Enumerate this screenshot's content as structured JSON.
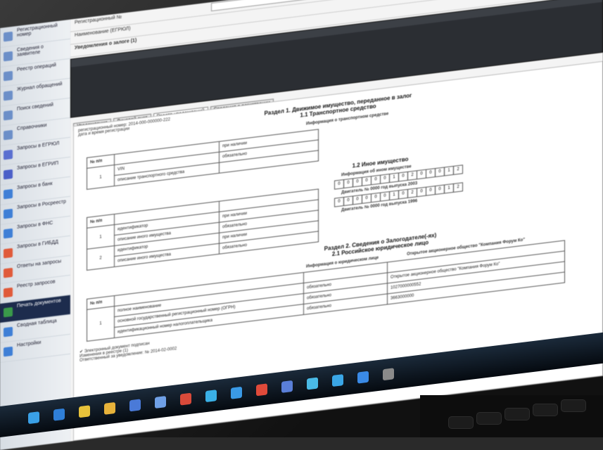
{
  "sidebar": {
    "items": [
      {
        "label": "Регистрационный номер",
        "icon": "document-icon",
        "color": "#6c8fc8"
      },
      {
        "label": "Сведения о заявителе",
        "icon": "document-icon",
        "color": "#6c8fc8"
      },
      {
        "label": "Реестр операций",
        "icon": "document-icon",
        "color": "#6c8fc8"
      },
      {
        "label": "Журнал обращений",
        "icon": "document-icon",
        "color": "#6c8fc8"
      },
      {
        "label": "Поиск сведений",
        "icon": "document-icon",
        "color": "#6c8fc8"
      },
      {
        "label": "Справочники",
        "icon": "document-icon",
        "color": "#6c8fc8"
      },
      {
        "label": "Запросы в ЕГРЮЛ",
        "icon": "folder-icon",
        "color": "#5a6fd0"
      },
      {
        "label": "Запросы в ЕГРИП",
        "icon": "folder-icon",
        "color": "#4b5fc8"
      },
      {
        "label": "Запросы в банк",
        "icon": "folder-icon",
        "color": "#3f7fd6"
      },
      {
        "label": "Запросы в Росреестр",
        "icon": "folder-icon",
        "color": "#3f7fd6"
      },
      {
        "label": "Запросы в ФНС",
        "icon": "folder-icon",
        "color": "#3f7fd6"
      },
      {
        "label": "Запросы в ГИБДД",
        "icon": "folder-icon",
        "color": "#e05a3a"
      },
      {
        "label": "Ответы на запросы",
        "icon": "folder-icon",
        "color": "#e05a3a"
      },
      {
        "label": "Реестр запросов",
        "icon": "folder-icon",
        "color": "#e05a3a"
      },
      {
        "label": "Печать документов",
        "icon": "printer-icon",
        "color": "#3a9a4a"
      },
      {
        "label": "Сводная таблица",
        "icon": "table-icon",
        "color": "#3f7fd6"
      },
      {
        "label": "Настройки",
        "icon": "gear-icon",
        "color": "#3f7fd6"
      }
    ]
  },
  "top": {
    "field1": "Регистрационный №",
    "field2": "Наименование (ЕГРЮЛ)",
    "notes_header": "Уведомления о залоге (1)"
  },
  "tabs": [
    {
      "label": "Уведомление",
      "selected": false
    },
    {
      "label": "Лицевой счет",
      "selected": false
    },
    {
      "label": "Реестр уведомлений",
      "selected": true
    },
    {
      "label": "Сведения о регистрации",
      "selected": false
    }
  ],
  "form": {
    "reg_line": "регистрационный номер: 2014-000-000000-222",
    "date_line": "дата и время регистрации",
    "section1_title": "Раздел 1. Движимое имущество, переданное в залог",
    "section11_title": "1.1 Транспортное средство",
    "vehicle_info_header": "Информация о транспортном средстве",
    "table1": {
      "col_no": "№ п/п",
      "row_no": "1",
      "row_a": "VIN",
      "row_b": "описание транспортного средства",
      "right_a": "при наличии",
      "right_b": "обязательно"
    },
    "section12_title": "1.2 Иное имущество",
    "other_info_header": "Информация об ином имуществе",
    "table2": {
      "col_no": "№ п/п",
      "rows": [
        {
          "no": "1",
          "a": "идентификатор",
          "b": "описание иного имущества",
          "ra": "при наличии",
          "rb": "обязательно"
        },
        {
          "no": "2",
          "a": "идентификатор",
          "b": "описание иного имущества",
          "ra": "при наличии",
          "rb": "обязательно"
        }
      ],
      "engine1": "Двигатель № 0000 год выпуска 2003",
      "engine2": "Двигатель № 0000 год выпуска 1996"
    },
    "cells_row": [
      "0",
      "0",
      "0",
      "0",
      "0",
      "0",
      "1",
      "0",
      "2",
      "0",
      "0",
      "0",
      "1",
      "2"
    ],
    "section2_title": "Раздел 2. Сведения о Залогодателе(-ях)",
    "section21_title": "2.1 Российское юридическое лицо",
    "legal_info_header": "Информация о юридическом лице",
    "legal_name": "Открытое акционерное общество \"Компания Форум Ко\"",
    "table3": {
      "col_no": "№ п/п",
      "row_no": "1",
      "a": "полное наименование",
      "b": "основной государственный регистрационный номер (ОГРН)",
      "c": "идентификационный номер налогоплательщика",
      "ra": "обязательно",
      "rb": "обязательно",
      "rc": "обязательно",
      "ogrn": "1027000000552",
      "inn": "3663000000"
    },
    "status": "Электронный документ подписан",
    "footer1": "Изменения в реестре (1)",
    "footer2": "Ответственный за уведомление: № 2014-02-0002"
  },
  "taskbar": {
    "icons": [
      {
        "name": "windows-start-icon",
        "color": "#3aa0e6"
      },
      {
        "name": "media-player-icon",
        "color": "#2f7fd8"
      },
      {
        "name": "chrome-icon",
        "color": "#e7c23a"
      },
      {
        "name": "folder-icon",
        "color": "#e7b23a"
      },
      {
        "name": "calendar-icon",
        "color": "#4a7ad8"
      },
      {
        "name": "monitor-icon",
        "color": "#6fa0e6"
      },
      {
        "name": "document-icon",
        "color": "#d84a3a"
      },
      {
        "name": "internet-explorer-icon",
        "color": "#3ab0e6"
      },
      {
        "name": "network-icon",
        "color": "#3a9ae6"
      },
      {
        "name": "pdf-icon",
        "color": "#e04a3a"
      },
      {
        "name": "presentation-icon",
        "color": "#5a7fd8"
      },
      {
        "name": "photo-icon",
        "color": "#4abae6"
      },
      {
        "name": "skype-icon",
        "color": "#3aa6e6"
      },
      {
        "name": "browser-icon",
        "color": "#3a8ae6"
      },
      {
        "name": "app-icon",
        "color": "#8a8a8a"
      }
    ]
  }
}
